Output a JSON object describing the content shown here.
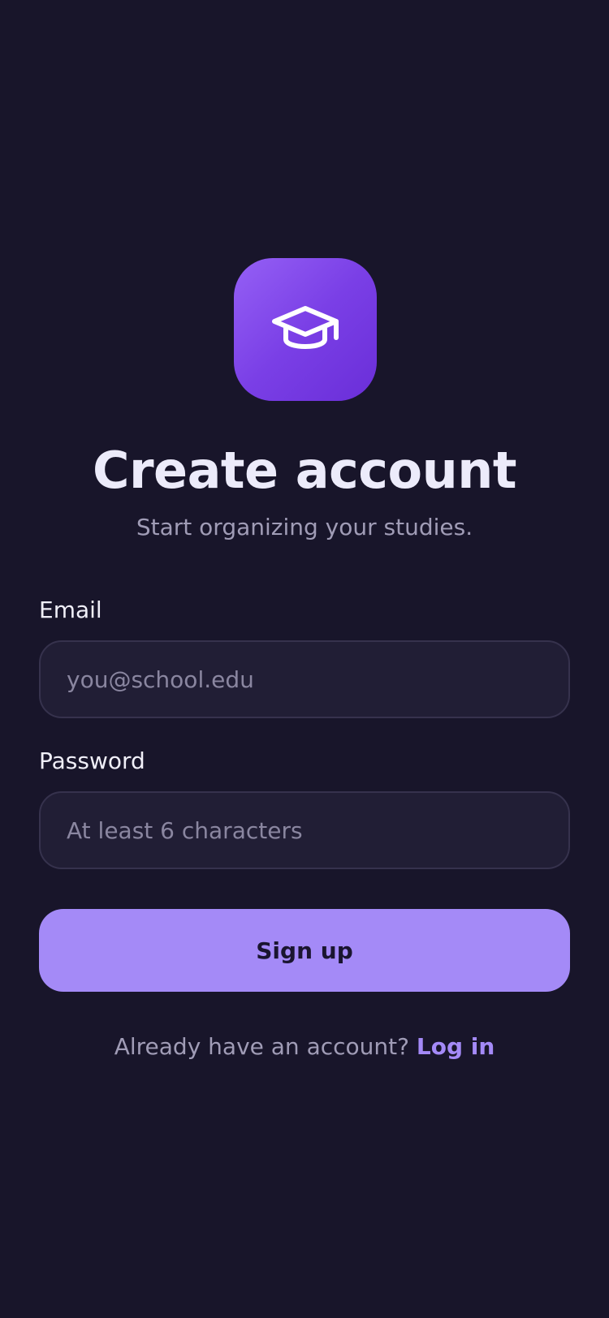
{
  "app": {
    "logo_icon": "graduation-cap-icon",
    "accent_color": "#a48af7",
    "background_color": "#18152a"
  },
  "header": {
    "title": "Create account",
    "subtitle": "Start organizing your studies."
  },
  "form": {
    "email": {
      "label": "Email",
      "value": "",
      "placeholder": "you@school.edu"
    },
    "password": {
      "label": "Password",
      "value": "",
      "placeholder": "At least 6 characters"
    },
    "submit_label": "Sign up"
  },
  "footer": {
    "prompt": "Already have an account?",
    "link_label": "Log in"
  }
}
